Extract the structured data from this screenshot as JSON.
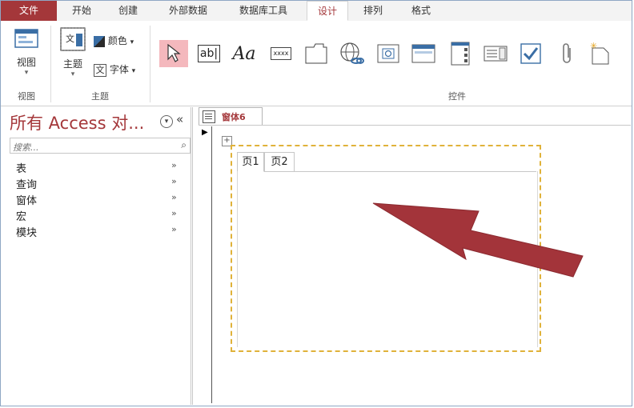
{
  "ribbon_tabs": [
    "文件",
    "开始",
    "创建",
    "外部数据",
    "数据库工具",
    "设计",
    "排列",
    "格式"
  ],
  "ribbon": {
    "view_label": "视图",
    "views_group": "视图",
    "theme_label": "主题",
    "colors_label": "颜色",
    "fonts_label": "字体",
    "themes_group": "主题",
    "textbox_icon_text": "ab|",
    "label_icon_text": "Aa",
    "button_icon_text": "xxxx",
    "controls_group": "控件"
  },
  "nav": {
    "title": "所有 Access 对...",
    "search_placeholder": "搜索...",
    "items": [
      "表",
      "查询",
      "窗体",
      "宏",
      "模块"
    ]
  },
  "document": {
    "tab_title": "窗体6",
    "page_tabs": [
      "页1",
      "页2"
    ]
  },
  "colors": {
    "accent": "#a4373a",
    "arrow": "#a3343a",
    "selection_border": "#e0b23a"
  }
}
